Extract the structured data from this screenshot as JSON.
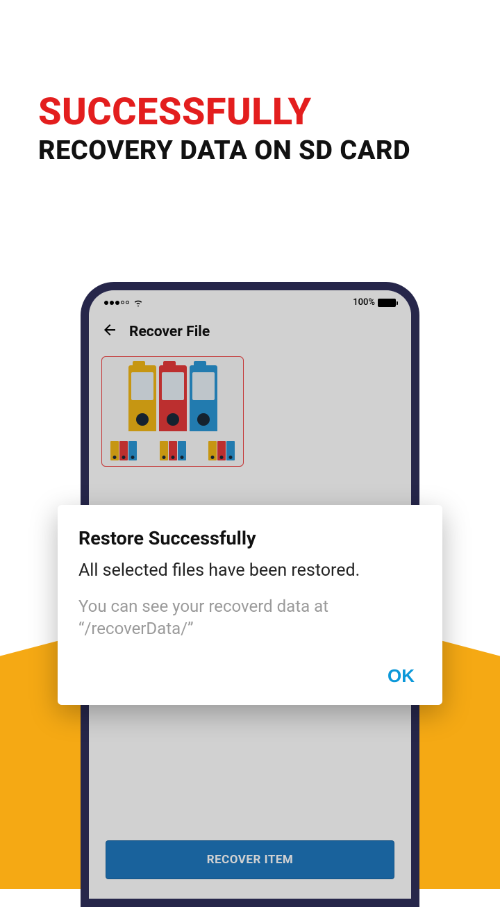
{
  "promo": {
    "line1": "SUCCESSFULLY",
    "line2": "RECOVERY DATA ON SD CARD"
  },
  "statusbar": {
    "battery_pct": "100%"
  },
  "app": {
    "title": "Recover File",
    "recover_button": "RECOVER ITEM"
  },
  "dialog": {
    "title": "Restore Successfully",
    "message": "All selected files have been restored.",
    "path_hint": "You can see your recoverd data at “/recoverData/”",
    "ok": "OK"
  }
}
